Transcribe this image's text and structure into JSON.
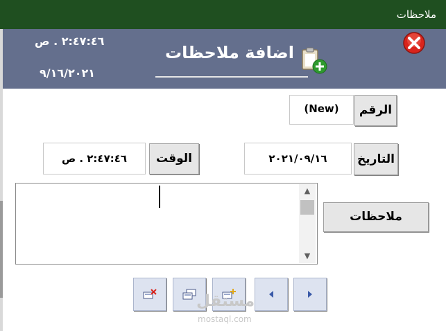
{
  "window": {
    "title": "ملاحظات"
  },
  "header": {
    "time": "٢:٤٧:٤٦ . ص",
    "date": "٩/١٦/٢٠٢١",
    "title": "اضافة ملاحظات"
  },
  "form": {
    "number_label": "الرقم",
    "number_value": "(New)",
    "date_label": "التاريخ",
    "date_value": "٢٠٢١/٠٩/١٦",
    "time_label": "الوقت",
    "time_value": "٢:٤٧:٤٦ . ص",
    "notes_label": "ملاحظات",
    "notes_value": ""
  },
  "watermark": {
    "text": "مستقل",
    "sub": "mostaql.com"
  },
  "colors": {
    "titlebar": "#1f4f20",
    "header": "#646f8d",
    "close": "#d9241c"
  }
}
